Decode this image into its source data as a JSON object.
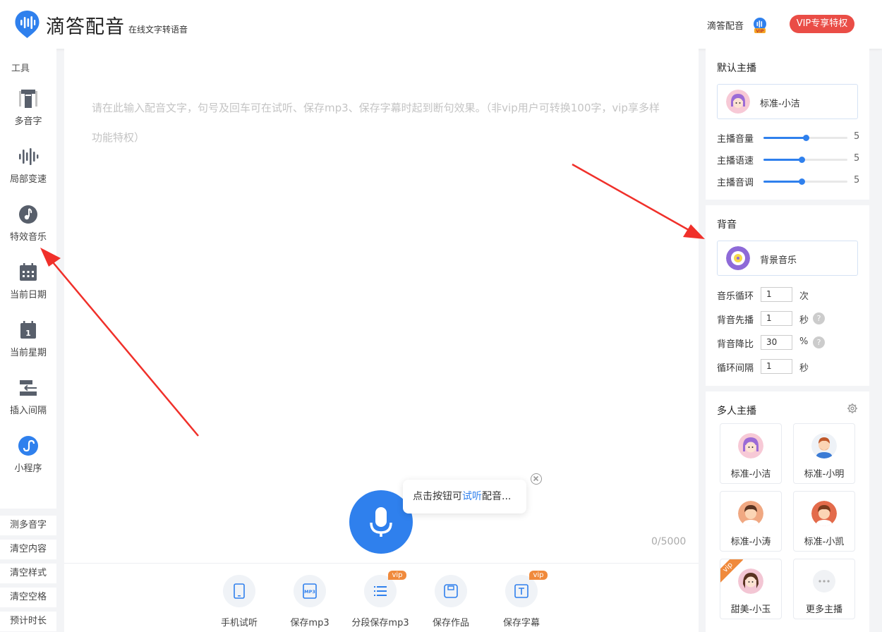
{
  "header": {
    "brand": "滴答配音",
    "tagline": "在线文字转语音",
    "user_name": "滴答配音",
    "vip_button": "VIP专享特权"
  },
  "toolbar": {
    "title": "工具",
    "tools": [
      {
        "label": "多音字",
        "icon": "polyphone-icon"
      },
      {
        "label": "局部变速",
        "icon": "waveform-icon"
      },
      {
        "label": "特效音乐",
        "icon": "music-note-icon"
      },
      {
        "label": "当前日期",
        "icon": "calendar-icon"
      },
      {
        "label": "当前星期",
        "icon": "calendar-day-icon"
      },
      {
        "label": "插入间隔",
        "icon": "insert-pause-icon"
      },
      {
        "label": "小程序",
        "icon": "mini-program-icon"
      }
    ],
    "buttons": [
      "测多音字",
      "清空内容",
      "清空样式",
      "清空空格",
      "预计时长"
    ]
  },
  "editor": {
    "placeholder": "请在此输入配音文字，句号及回车可在试听、保存mp3、保存字幕时起到断句效果。（非vip用户可转换100字，vip享多样功能特权）",
    "tip_before": "点击按钮可",
    "tip_link": "试听",
    "tip_after": "配音...",
    "counter": "0/5000"
  },
  "actions": [
    {
      "label": "手机试听",
      "icon": "phone-icon",
      "vip": ""
    },
    {
      "label": "保存mp3",
      "icon": "mp3-file-icon",
      "vip": ""
    },
    {
      "label": "分段保存mp3",
      "icon": "list-icon",
      "vip": "vip"
    },
    {
      "label": "保存作品",
      "icon": "save-icon",
      "vip": ""
    },
    {
      "label": "保存字幕",
      "icon": "subtitle-icon",
      "vip": "vip"
    }
  ],
  "anchor": {
    "title": "默认主播",
    "voice": "标准-小洁",
    "sliders": [
      {
        "label": "主播音量",
        "value": 5,
        "fraction": 0.5
      },
      {
        "label": "主播语速",
        "value": 5,
        "fraction": 0.45
      },
      {
        "label": "主播音调",
        "value": 5,
        "fraction": 0.45
      }
    ]
  },
  "bgm": {
    "title": "背音",
    "music": "背景音乐",
    "rows": [
      {
        "label": "音乐循环",
        "value": "1",
        "unit": "次",
        "help": false
      },
      {
        "label": "背音先播",
        "value": "1",
        "unit": "秒",
        "help": true
      },
      {
        "label": "背音降比",
        "value": "30",
        "unit": "%",
        "help": true
      },
      {
        "label": "循环间隔",
        "value": "1",
        "unit": "秒",
        "help": false
      }
    ],
    "help_glyph": "?"
  },
  "multi": {
    "title": "多人主播",
    "voices": [
      {
        "label": "标准-小洁",
        "vip": ""
      },
      {
        "label": "标准-小明",
        "vip": ""
      },
      {
        "label": "标准-小涛",
        "vip": ""
      },
      {
        "label": "标准-小凯",
        "vip": ""
      },
      {
        "label": "甜美-小玉",
        "vip": "vip"
      },
      {
        "label": "更多主播",
        "vip": ""
      }
    ]
  },
  "colors": {
    "accent": "#2f80ed",
    "vip_red": "#ea4d46",
    "vip_orange": "#f08a3c",
    "arrow": "#f0302a"
  }
}
